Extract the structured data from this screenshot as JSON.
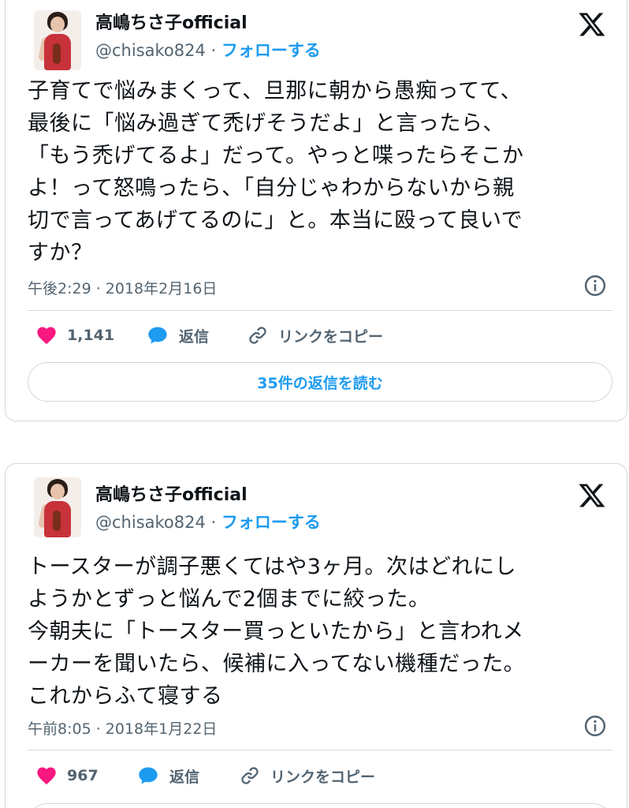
{
  "tweets": [
    {
      "author_name": "高嶋ちさ子official",
      "handle": "@chisako824",
      "separator": "·",
      "follow_label": "フォローする",
      "text_lines": [
        "子育てで悩みまくって、旦那に朝から愚痴ってて、",
        "最後に「悩み過ぎて禿げそうだよ」と言ったら、",
        "「もう禿げてるよ」だって。やっと喋ったらそこか",
        "よ！って怒鳴ったら、「自分じゃわからないから親",
        "切で言ってあげてるのに」と。本当に殴って良いで",
        "すか？"
      ],
      "timestamp": "午後2:29 · 2018年2月16日",
      "like_count": "1,141",
      "reply_label": "返信",
      "copy_link_label": "リンクをコピー",
      "read_replies_label": "35件の返信を読む"
    },
    {
      "author_name": "高嶋ちさ子official",
      "handle": "@chisako824",
      "separator": "·",
      "follow_label": "フォローする",
      "text_lines": [
        "トースターが調子悪くてはや3ヶ月。次はどれにし",
        "ようかとずっと悩んで2個までに絞った。",
        "今朝夫に「トースター買っといたから」と言われメ",
        "ーカーを聞いたら、候補に入ってない機種だった。",
        "これからふて寝する"
      ],
      "timestamp": "午前8:05 · 2018年1月22日",
      "like_count": "967",
      "reply_label": "返信",
      "copy_link_label": "リンクをコピー"
    }
  ],
  "icons": {
    "like": "heart-icon",
    "reply": "speech-bubble-icon",
    "copy_link": "link-icon",
    "info": "info-icon",
    "brand": "x-logo-icon"
  },
  "colors": {
    "like": "#f91880",
    "reply": "#1d9bf0",
    "link_accent": "#1d9bf0",
    "muted": "#536471",
    "border": "#cfd9de"
  }
}
